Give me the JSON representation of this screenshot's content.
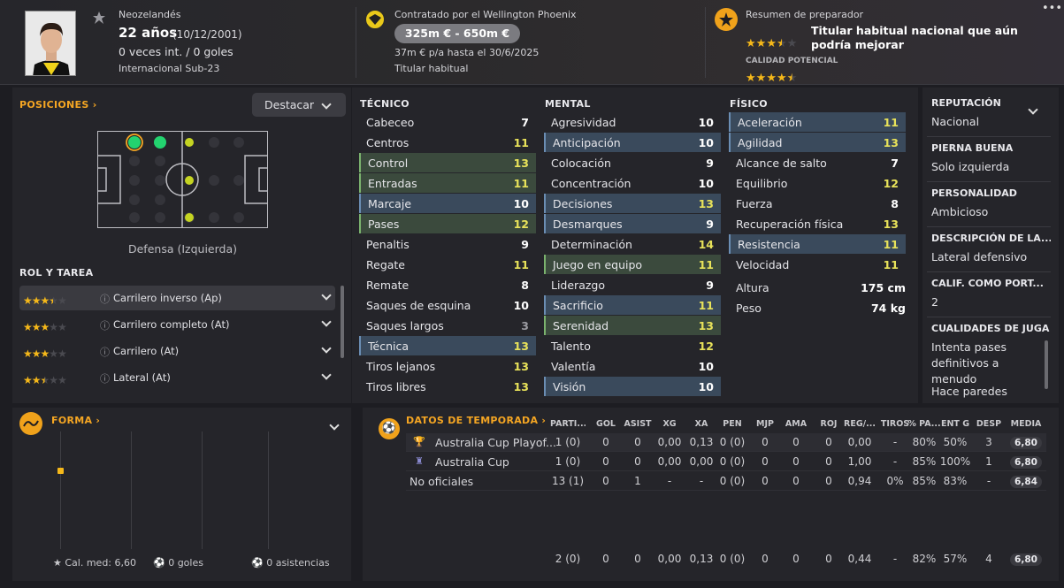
{
  "header": {
    "nationality": "Neozelandés",
    "age": "22 años",
    "birth": "(10/12/2001)",
    "caps": "0 veces int. / 0 goles",
    "international": "Internacional Sub-23",
    "contract": "Contratado por el Wellington Phoenix",
    "value": "325m € - 650m €",
    "wage": "37m € p/a hasta el 30/6/2025",
    "status": "Titular habitual",
    "coach_title": "Resumen de preparador",
    "coach_text": "Titular habitual nacional que aún podría mejorar",
    "potential_label": "CALIDAD POTENCIAL",
    "current_stars": 3.5,
    "potential_stars": 4.5
  },
  "positions": {
    "title": "POSICIONES",
    "highlight_button": "Destacar",
    "position_label": "Defensa (Izquierda)"
  },
  "roles": {
    "title": "ROL Y TAREA",
    "items": [
      {
        "label": "Carrilero inverso (Ap)",
        "stars": 3.5
      },
      {
        "label": "Carrilero completo (At)",
        "stars": 3
      },
      {
        "label": "Carrilero (At)",
        "stars": 3
      },
      {
        "label": "Lateral (At)",
        "stars": 2.5
      }
    ]
  },
  "attributes": {
    "technical_title": "TÉCNICO",
    "mental_title": "MENTAL",
    "physical_title": "FÍSICO",
    "technical": [
      {
        "n": "Cabeceo",
        "v": "7",
        "h": ""
      },
      {
        "n": "Centros",
        "v": "11",
        "h": ""
      },
      {
        "n": "Control",
        "v": "13",
        "h": "green"
      },
      {
        "n": "Entradas",
        "v": "11",
        "h": "green"
      },
      {
        "n": "Marcaje",
        "v": "10",
        "h": "blue"
      },
      {
        "n": "Pases",
        "v": "12",
        "h": "green"
      },
      {
        "n": "Penaltis",
        "v": "9",
        "h": ""
      },
      {
        "n": "Regate",
        "v": "11",
        "h": ""
      },
      {
        "n": "Remate",
        "v": "8",
        "h": ""
      },
      {
        "n": "Saques de esquina",
        "v": "10",
        "h": ""
      },
      {
        "n": "Saques largos",
        "v": "3",
        "h": ""
      },
      {
        "n": "Técnica",
        "v": "13",
        "h": "blue"
      },
      {
        "n": "Tiros lejanos",
        "v": "13",
        "h": ""
      },
      {
        "n": "Tiros libres",
        "v": "13",
        "h": ""
      }
    ],
    "mental": [
      {
        "n": "Agresividad",
        "v": "10",
        "h": ""
      },
      {
        "n": "Anticipación",
        "v": "10",
        "h": "blue"
      },
      {
        "n": "Colocación",
        "v": "9",
        "h": ""
      },
      {
        "n": "Concentración",
        "v": "10",
        "h": ""
      },
      {
        "n": "Decisiones",
        "v": "13",
        "h": "blue"
      },
      {
        "n": "Desmarques",
        "v": "9",
        "h": "blue"
      },
      {
        "n": "Determinación",
        "v": "14",
        "h": ""
      },
      {
        "n": "Juego en equipo",
        "v": "11",
        "h": "green"
      },
      {
        "n": "Liderazgo",
        "v": "9",
        "h": ""
      },
      {
        "n": "Sacrificio",
        "v": "11",
        "h": "blue"
      },
      {
        "n": "Serenidad",
        "v": "13",
        "h": "green"
      },
      {
        "n": "Talento",
        "v": "12",
        "h": ""
      },
      {
        "n": "Valentía",
        "v": "10",
        "h": ""
      },
      {
        "n": "Visión",
        "v": "10",
        "h": "blue"
      }
    ],
    "physical": [
      {
        "n": "Aceleración",
        "v": "11",
        "h": "blue"
      },
      {
        "n": "Agilidad",
        "v": "13",
        "h": "blue"
      },
      {
        "n": "Alcance de salto",
        "v": "7",
        "h": ""
      },
      {
        "n": "Equilibrio",
        "v": "12",
        "h": ""
      },
      {
        "n": "Fuerza",
        "v": "8",
        "h": ""
      },
      {
        "n": "Recuperación física",
        "v": "13",
        "h": ""
      },
      {
        "n": "Resistencia",
        "v": "11",
        "h": "blue"
      },
      {
        "n": "Velocidad",
        "v": "11",
        "h": ""
      }
    ],
    "height_label": "Altura",
    "height": "175 cm",
    "weight_label": "Peso",
    "weight": "74 kg"
  },
  "info": [
    {
      "label": "REPUTACIÓN",
      "value": "Nacional"
    },
    {
      "label": "PIERNA BUENA",
      "value": "Solo izquierda"
    },
    {
      "label": "PERSONALIDAD",
      "value": "Ambicioso"
    },
    {
      "label": "DESCRIPCIÓN DE LA...",
      "value": "Lateral defensivo"
    },
    {
      "label": "CALIF. COMO PORT...",
      "value": "2"
    },
    {
      "label": "CUALIDADES DE JUGA",
      "value": "Intenta pases definitivos a menudo"
    },
    {
      "label": "",
      "value": "Hace paredes"
    }
  ],
  "form": {
    "title": "FORMA",
    "avg": "Cal. med: 6,60",
    "goals": "0 goles",
    "assists": "0 asistencias"
  },
  "season": {
    "title": "DATOS DE TEMPORADA",
    "headers": [
      "PARTI...",
      "GOL",
      "ASIST",
      "XG",
      "XA",
      "PEN",
      "MJP",
      "AMA",
      "ROJ",
      "REG/...",
      "TIROS",
      "% PA...",
      "ENT G",
      "DESP",
      "MEDIA"
    ],
    "rows": [
      {
        "name": "Australia Cup Playof...",
        "cells": [
          "1 (0)",
          "0",
          "0",
          "0,00",
          "0,13",
          "0 (0)",
          "0",
          "0",
          "0",
          "0,00",
          "-",
          "80%",
          "50%",
          "3",
          "6,80"
        ]
      },
      {
        "name": "Australia Cup",
        "cells": [
          "1 (0)",
          "0",
          "0",
          "0,00",
          "0,00",
          "0 (0)",
          "0",
          "0",
          "0",
          "1,00",
          "-",
          "85%",
          "100%",
          "1",
          "6,80"
        ]
      },
      {
        "name": "No oficiales",
        "cells": [
          "13 (1)",
          "0",
          "1",
          "-",
          "-",
          "0 (0)",
          "0",
          "0",
          "0",
          "0,94",
          "0%",
          "85%",
          "83%",
          "-",
          "6,84"
        ]
      }
    ],
    "total": [
      "2 (0)",
      "0",
      "0",
      "0,00",
      "0,13",
      "0 (0)",
      "0",
      "0",
      "0",
      "0,44",
      "-",
      "82%",
      "57%",
      "4",
      "6,80"
    ]
  }
}
